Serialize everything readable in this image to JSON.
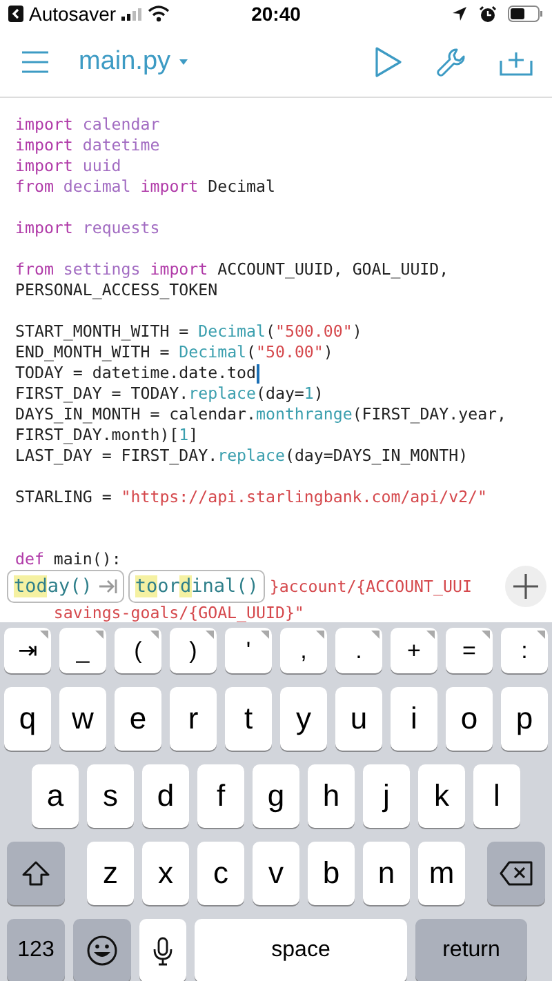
{
  "status_bar": {
    "back_label": "Autosaver",
    "time": "20:40"
  },
  "toolbar": {
    "filename": "main.py"
  },
  "code_lines": [
    {
      "kind": "code",
      "tokens": [
        {
          "kind": "keyword",
          "text": "import"
        },
        {
          "kind": "name",
          "text": " calendar"
        }
      ]
    },
    {
      "kind": "code",
      "tokens": [
        {
          "kind": "keyword",
          "text": "import"
        },
        {
          "kind": "name",
          "text": " datetime"
        }
      ]
    },
    {
      "kind": "code",
      "tokens": [
        {
          "kind": "keyword",
          "text": "import"
        },
        {
          "kind": "name",
          "text": " uuid"
        }
      ]
    },
    {
      "kind": "code",
      "tokens": [
        {
          "kind": "keyword",
          "text": "from"
        },
        {
          "kind": "name",
          "text": " decimal "
        },
        {
          "kind": "keyword",
          "text": "import"
        },
        {
          "kind": "plain",
          "text": " Decimal"
        }
      ]
    },
    {
      "kind": "blank"
    },
    {
      "kind": "code",
      "tokens": [
        {
          "kind": "keyword",
          "text": "import"
        },
        {
          "kind": "name",
          "text": " requests"
        }
      ]
    },
    {
      "kind": "blank"
    },
    {
      "kind": "code",
      "tokens": [
        {
          "kind": "keyword",
          "text": "from"
        },
        {
          "kind": "name",
          "text": " settings "
        },
        {
          "kind": "keyword",
          "text": "import"
        },
        {
          "kind": "plain",
          "text": " ACCOUNT_UUID, GOAL_UUID,"
        }
      ]
    },
    {
      "kind": "code",
      "tokens": [
        {
          "kind": "plain",
          "text": "PERSONAL_ACCESS_TOKEN"
        }
      ]
    },
    {
      "kind": "blank"
    },
    {
      "kind": "code",
      "tokens": [
        {
          "kind": "plain",
          "text": "START_MONTH_WITH = "
        },
        {
          "kind": "call",
          "text": "Decimal"
        },
        {
          "kind": "plain",
          "text": "("
        },
        {
          "kind": "string",
          "text": "\"500.00\""
        },
        {
          "kind": "plain",
          "text": ")"
        }
      ]
    },
    {
      "kind": "code",
      "tokens": [
        {
          "kind": "plain",
          "text": "END_MONTH_WITH = "
        },
        {
          "kind": "call",
          "text": "Decimal"
        },
        {
          "kind": "plain",
          "text": "("
        },
        {
          "kind": "string",
          "text": "\"50.00\""
        },
        {
          "kind": "plain",
          "text": ")"
        }
      ]
    },
    {
      "kind": "code",
      "tokens": [
        {
          "kind": "plain",
          "text": "TODAY = datetime.date.tod"
        },
        {
          "kind": "cursor"
        }
      ]
    },
    {
      "kind": "code",
      "tokens": [
        {
          "kind": "plain",
          "text": "FIRST_DAY = TODAY."
        },
        {
          "kind": "call",
          "text": "replace"
        },
        {
          "kind": "plain",
          "text": "(day="
        },
        {
          "kind": "number",
          "text": "1"
        },
        {
          "kind": "plain",
          "text": ")"
        }
      ]
    },
    {
      "kind": "code",
      "tokens": [
        {
          "kind": "plain",
          "text": "DAYS_IN_MONTH = calendar."
        },
        {
          "kind": "call",
          "text": "monthrange"
        },
        {
          "kind": "plain",
          "text": "(FIRST_DAY.year,"
        }
      ]
    },
    {
      "kind": "code",
      "tokens": [
        {
          "kind": "plain",
          "text": "FIRST_DAY.month)["
        },
        {
          "kind": "number",
          "text": "1"
        },
        {
          "kind": "plain",
          "text": "]"
        }
      ]
    },
    {
      "kind": "code",
      "tokens": [
        {
          "kind": "plain",
          "text": "LAST_DAY = FIRST_DAY."
        },
        {
          "kind": "call",
          "text": "replace"
        },
        {
          "kind": "plain",
          "text": "(day=DAYS_IN_MONTH)"
        }
      ]
    },
    {
      "kind": "blank"
    },
    {
      "kind": "code",
      "tokens": [
        {
          "kind": "plain",
          "text": "STARLING = "
        },
        {
          "kind": "string",
          "text": "\"https://api.starlingbank.com/api/v2/\""
        }
      ]
    },
    {
      "kind": "blank"
    },
    {
      "kind": "blank"
    },
    {
      "kind": "code",
      "tokens": [
        {
          "kind": "keyword",
          "text": "def"
        },
        {
          "kind": "plain",
          "text": " main():"
        }
      ]
    }
  ],
  "suggestion_bar": {
    "suggestions": [
      {
        "kind": "complete",
        "parts": [
          {
            "text": "tod",
            "matched": true
          },
          {
            "text": "ay()",
            "matched": false
          }
        ]
      },
      {
        "kind": "plain",
        "parts": [
          {
            "text": "to",
            "matched": true
          },
          {
            "text": "or",
            "matched": false
          },
          {
            "text": "d",
            "matched": true
          },
          {
            "text": "inal()",
            "matched": false
          }
        ]
      }
    ],
    "code_behind": "}account/{ACCOUNT_UUI"
  },
  "code_after": [
    {
      "kind": "code",
      "tokens": [
        {
          "kind": "string",
          "text": "    savings-goals/{GOAL_UUID}\""
        }
      ]
    }
  ],
  "keyboard": {
    "rows": [
      {
        "keys": [
          {
            "kind": "symbol",
            "label": "⇥"
          },
          {
            "kind": "symbol",
            "label": "_"
          },
          {
            "kind": "symbol",
            "label": "("
          },
          {
            "kind": "symbol",
            "label": ")"
          },
          {
            "kind": "symbol",
            "label": "'"
          },
          {
            "kind": "symbol",
            "label": ","
          },
          {
            "kind": "symbol",
            "label": "."
          },
          {
            "kind": "symbol",
            "label": "+"
          },
          {
            "kind": "symbol",
            "label": "="
          },
          {
            "kind": "symbol",
            "label": ":"
          }
        ]
      },
      {
        "keys": [
          {
            "kind": "letter",
            "label": "q"
          },
          {
            "kind": "letter",
            "label": "w"
          },
          {
            "kind": "letter",
            "label": "e"
          },
          {
            "kind": "letter",
            "label": "r"
          },
          {
            "kind": "letter",
            "label": "t"
          },
          {
            "kind": "letter",
            "label": "y"
          },
          {
            "kind": "letter",
            "label": "u"
          },
          {
            "kind": "letter",
            "label": "i"
          },
          {
            "kind": "letter",
            "label": "o"
          },
          {
            "kind": "letter",
            "label": "p"
          }
        ]
      },
      {
        "keys": [
          {
            "kind": "letter",
            "label": "a"
          },
          {
            "kind": "letter",
            "label": "s"
          },
          {
            "kind": "letter",
            "label": "d"
          },
          {
            "kind": "letter",
            "label": "f"
          },
          {
            "kind": "letter",
            "label": "g"
          },
          {
            "kind": "letter",
            "label": "h"
          },
          {
            "kind": "letter",
            "label": "j"
          },
          {
            "kind": "letter",
            "label": "k"
          },
          {
            "kind": "letter",
            "label": "l"
          }
        ]
      },
      {
        "keys": [
          {
            "kind": "shift"
          },
          {
            "kind": "letter",
            "label": "z"
          },
          {
            "kind": "letter",
            "label": "x"
          },
          {
            "kind": "letter",
            "label": "c"
          },
          {
            "kind": "letter",
            "label": "v"
          },
          {
            "kind": "letter",
            "label": "b"
          },
          {
            "kind": "letter",
            "label": "n"
          },
          {
            "kind": "letter",
            "label": "m"
          },
          {
            "kind": "delete"
          }
        ]
      },
      {
        "keys": [
          {
            "kind": "numbers",
            "label": "123"
          },
          {
            "kind": "emoji"
          },
          {
            "kind": "mic"
          },
          {
            "kind": "space",
            "label": "space"
          },
          {
            "kind": "return",
            "label": "return"
          }
        ]
      }
    ]
  }
}
